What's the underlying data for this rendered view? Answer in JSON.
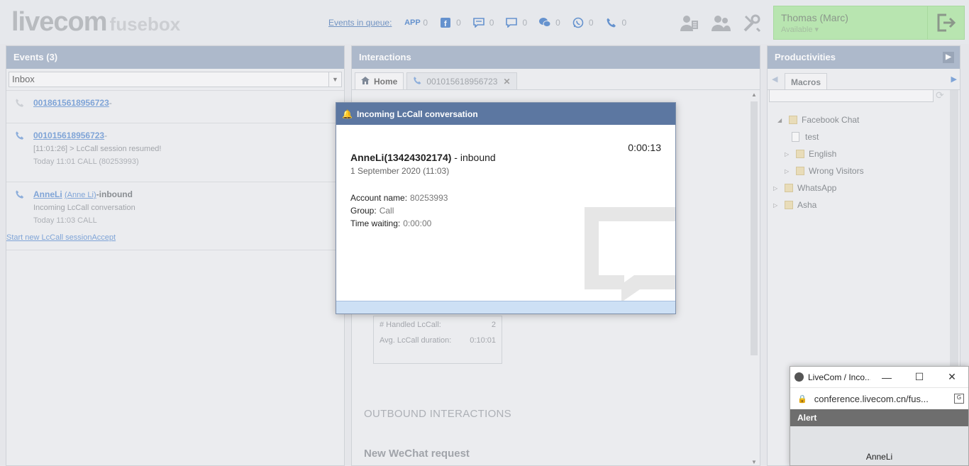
{
  "header": {
    "logo": "livecom",
    "logo_sub": "fusebox",
    "queue_label": "Events in queue:",
    "queue": [
      {
        "icon": "app-icon",
        "glyph": "APP",
        "count": "0"
      },
      {
        "icon": "facebook-icon",
        "glyph": "f",
        "count": "0"
      },
      {
        "icon": "chat-bubble-icon",
        "glyph": "",
        "count": "0"
      },
      {
        "icon": "message-icon",
        "glyph": "",
        "count": "0"
      },
      {
        "icon": "wechat-icon",
        "glyph": "",
        "count": "0"
      },
      {
        "icon": "whatsapp-icon",
        "glyph": "",
        "count": "0"
      },
      {
        "icon": "phone-icon",
        "glyph": "",
        "count": "0"
      }
    ],
    "user_name": "Thomas (Marc)",
    "user_status": "Available"
  },
  "events": {
    "title": "Events (3)",
    "filter": "Inbox",
    "items": [
      {
        "number": "0018615618956723",
        "suffix": "-",
        "line1": "",
        "line2": ""
      },
      {
        "number": "001015618956723",
        "suffix": "-",
        "line1": "[11:01:26] > LcCall session resumed!",
        "line2": "Today 11:01 CALL (80253993)"
      },
      {
        "number": "AnneLi",
        "alias": "(Anne Li)",
        "suffix": "-inbound",
        "line1": "Incoming LcCall conversation",
        "line2": "Today 11:03 CALL"
      }
    ],
    "action_link": "Start new LcCall sessionAccept"
  },
  "interactions": {
    "title": "Interactions",
    "tab_home": "Home",
    "tab_call": "001015618956723",
    "stats": [
      {
        "label": "# Handled LcCall:",
        "value": "2"
      },
      {
        "label": "Avg. LcCall duration:",
        "value": "0:10:01"
      }
    ],
    "outbound_heading": "OUTBOUND INTERACTIONS",
    "new_wechat": "New WeChat request"
  },
  "productivities": {
    "title": "Productivities",
    "tab": "Macros",
    "tree": [
      {
        "label": "Facebook Chat",
        "type": "folder",
        "expanded": true,
        "level": 0
      },
      {
        "label": "test",
        "type": "doc",
        "level": 1
      },
      {
        "label": "English",
        "type": "folder",
        "expanded": false,
        "level": 1
      },
      {
        "label": "Wrong Visitors",
        "type": "folder",
        "expanded": false,
        "level": 1
      },
      {
        "label": "WhatsApp",
        "type": "folder",
        "expanded": false,
        "level": 0
      },
      {
        "label": "Asha",
        "type": "folder",
        "expanded": false,
        "level": 0
      }
    ]
  },
  "modal": {
    "title": "Incoming LcCall conversation",
    "caller": "AnneLi(13424302174)",
    "direction": " - inbound",
    "date": "1 September 2020 (11:03)",
    "timer": "0:00:13",
    "account_label": "Account name:",
    "account_value": "80253993",
    "group_label": "Group:",
    "group_value": "Call",
    "waiting_label": "Time waiting:",
    "waiting_value": "0:00:00"
  },
  "popup": {
    "title": "LiveCom / Inco...",
    "url": "conference.livecom.cn/fus...",
    "alert": "Alert",
    "who": "AnneLi"
  },
  "colors": {
    "panel_header": "#9aaac0",
    "modal_header": "#5c77a1",
    "user_box": "#a8e59c",
    "link": "#5d8ed0"
  }
}
